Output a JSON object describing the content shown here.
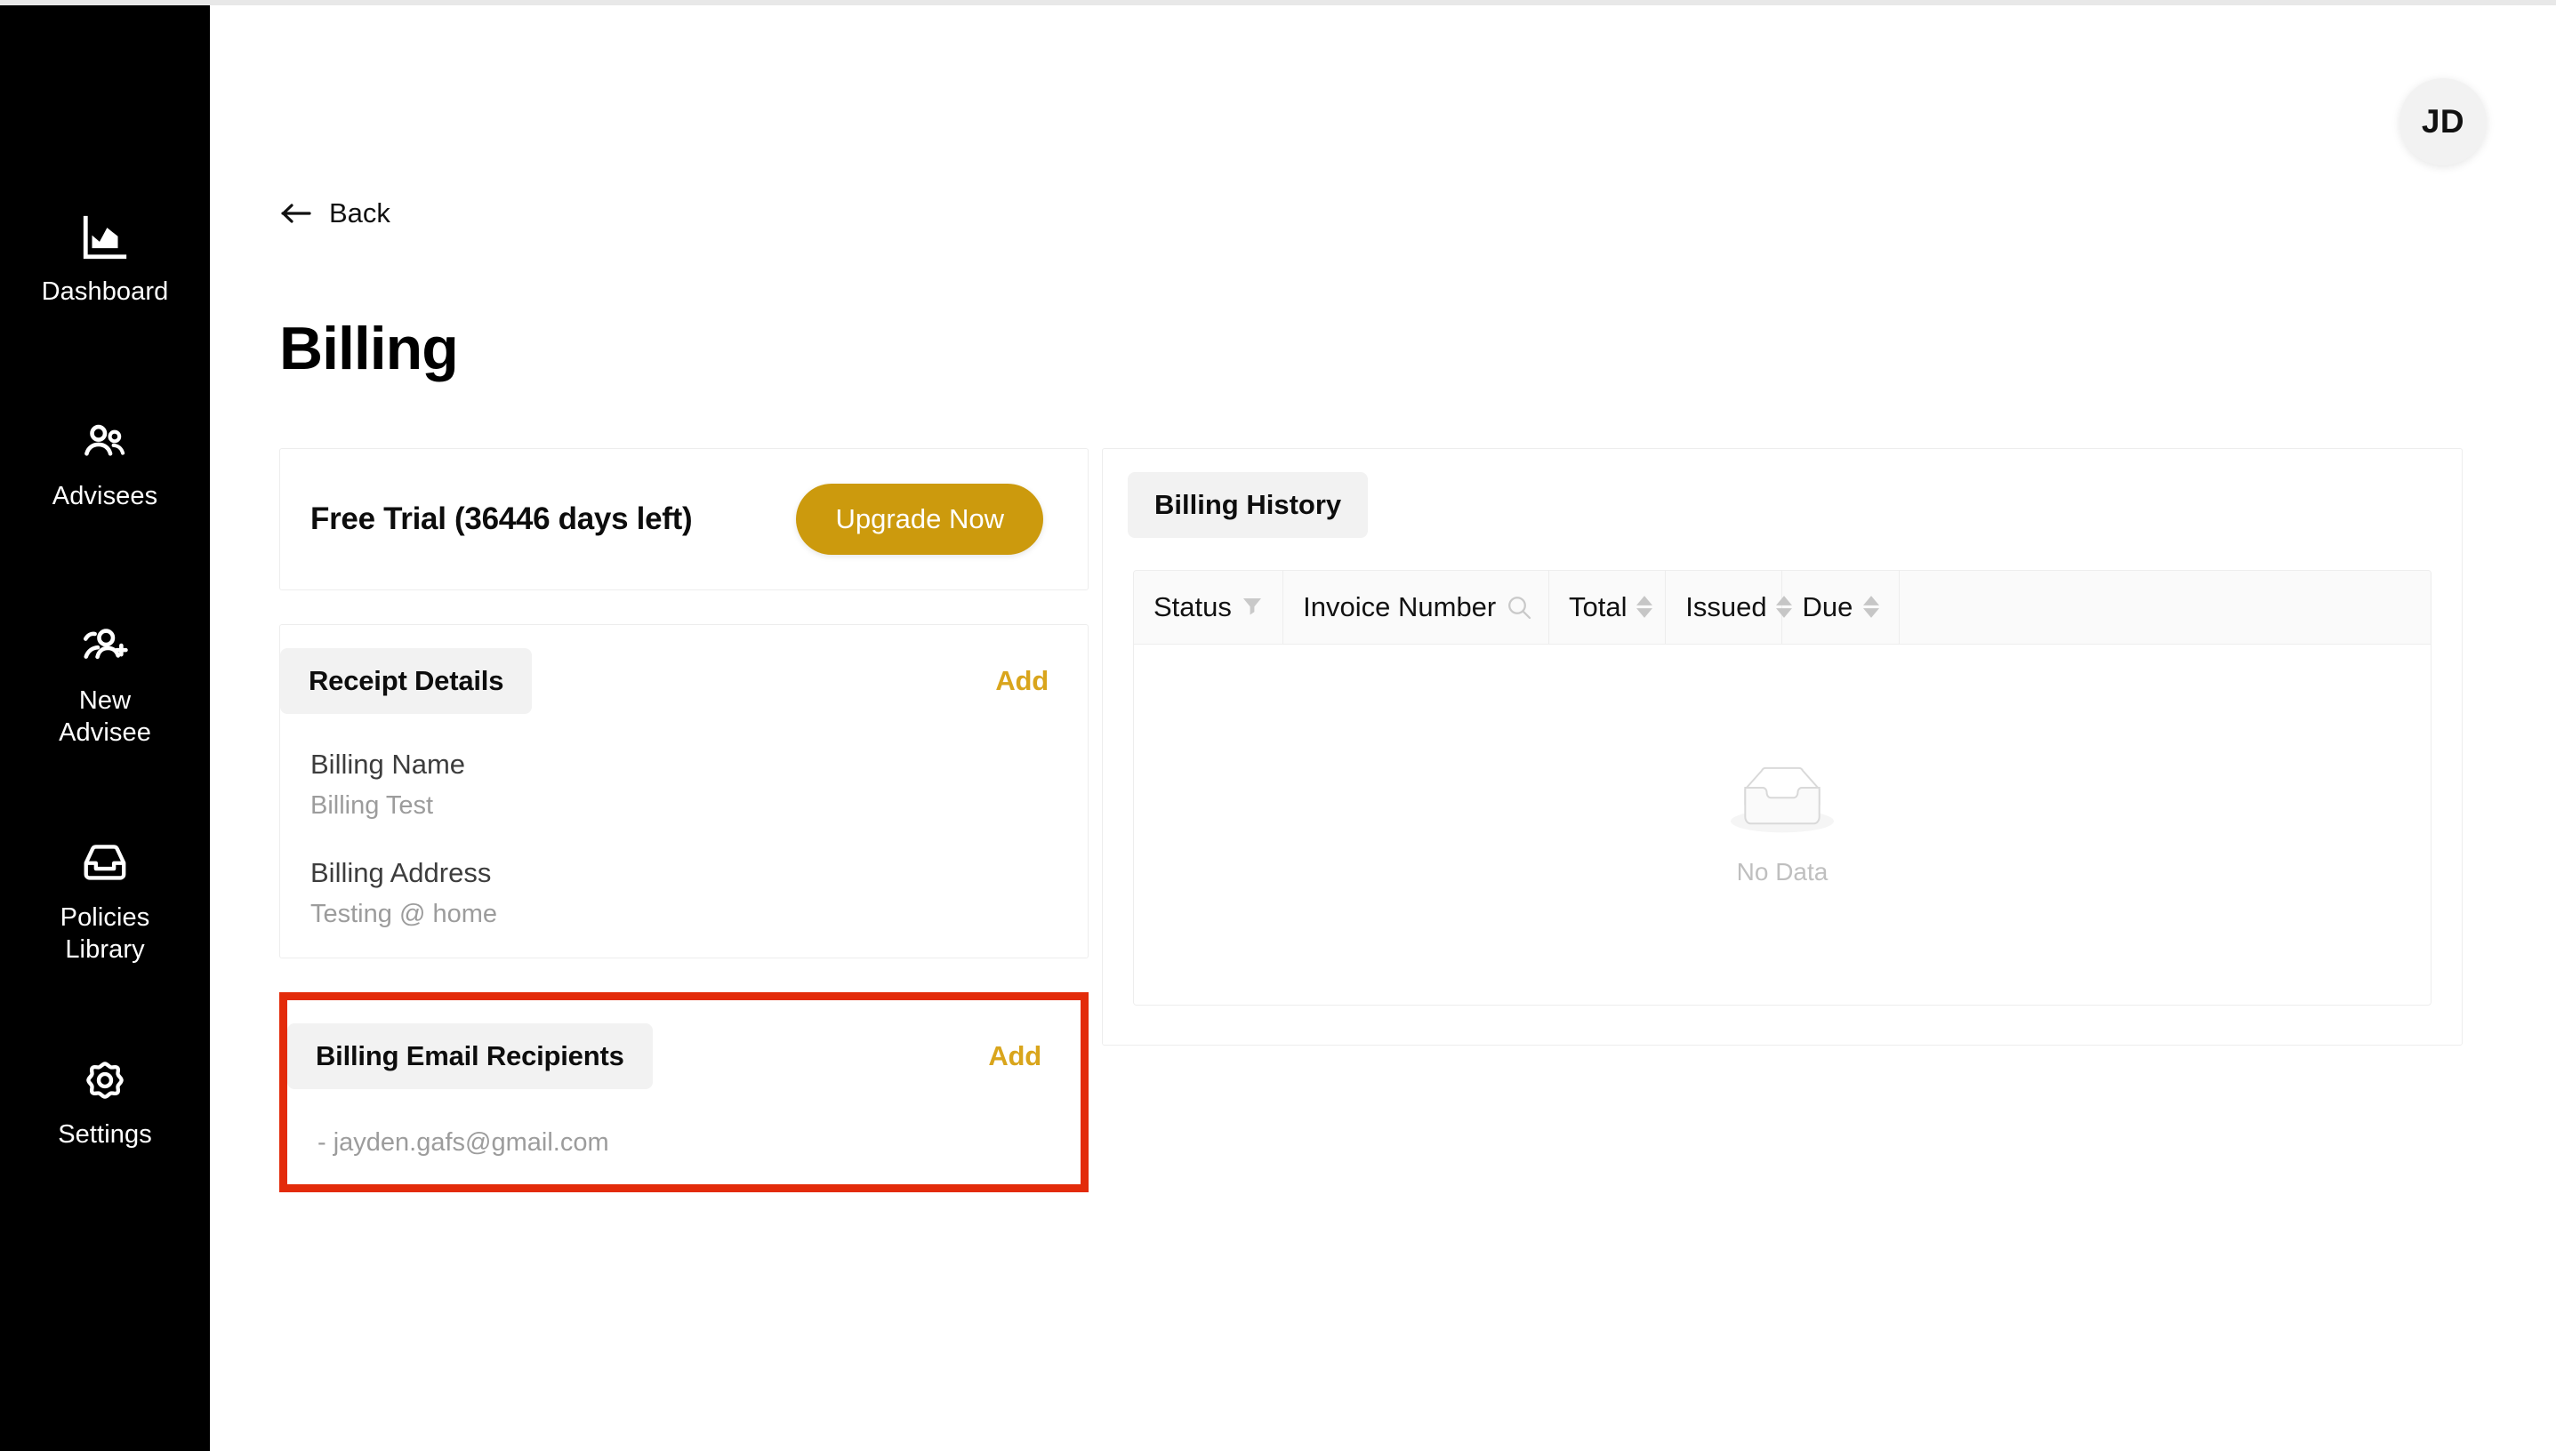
{
  "sidebar": {
    "items": [
      {
        "label": "Dashboard",
        "icon": "chart-icon"
      },
      {
        "label": "Advisees",
        "icon": "people-icon"
      },
      {
        "label": "New\nAdvisee",
        "label_line1": "New",
        "label_line2": "Advisee",
        "icon": "person-add-icon"
      },
      {
        "label": "Policies\nLibrary",
        "label_line1": "Policies",
        "label_line2": "Library",
        "icon": "inbox-icon"
      },
      {
        "label": "Settings",
        "icon": "gear-icon"
      }
    ]
  },
  "header": {
    "avatar_initials": "JD",
    "back_label": "Back",
    "page_title": "Billing"
  },
  "trial": {
    "text": "Free Trial (36446 days left)",
    "upgrade_label": "Upgrade Now"
  },
  "receipt_details": {
    "title": "Receipt Details",
    "add_label": "Add",
    "fields": [
      {
        "label": "Billing Name",
        "value": "Billing Test"
      },
      {
        "label": "Billing Address",
        "value": "Testing @ home"
      }
    ]
  },
  "billing_email_recipients": {
    "title": "Billing Email Recipients",
    "add_label": "Add",
    "recipients": [
      {
        "text": "- jayden.gafs@gmail.com"
      }
    ]
  },
  "billing_history": {
    "title": "Billing History",
    "columns": [
      {
        "label": "Status",
        "icon": "filter-icon"
      },
      {
        "label": "Invoice Number",
        "icon": "search-icon"
      },
      {
        "label": "Total",
        "icon": "sort-icon"
      },
      {
        "label": "Issued",
        "icon": "sort-icon"
      },
      {
        "label": "Due",
        "icon": "sort-icon"
      }
    ],
    "rows": [],
    "empty_text": "No Data",
    "empty_icon": "empty-box-icon"
  },
  "colors": {
    "accent_gold": "#cc9a0d",
    "add_link_gold": "#d9a51c",
    "sidebar_bg": "#000000",
    "highlight_red": "#e32b0a"
  }
}
